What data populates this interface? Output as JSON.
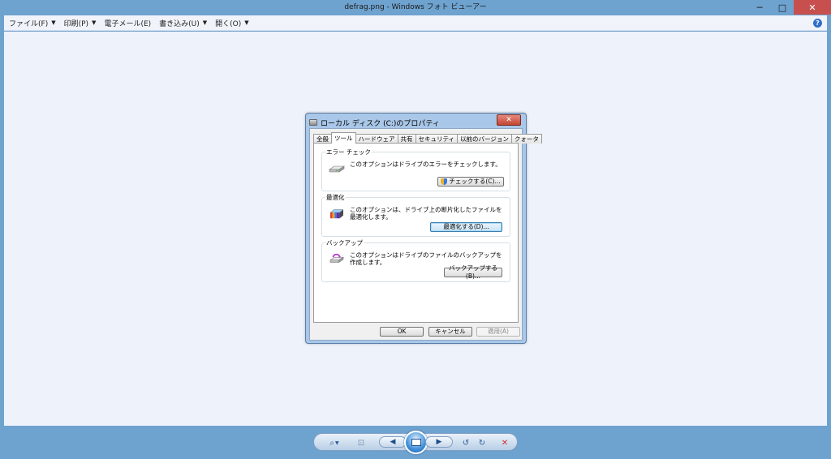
{
  "window": {
    "title": "defrag.png - Windows フォト ビューアー",
    "controls": {
      "minimize": "─",
      "maximize": "□",
      "close": "✕"
    }
  },
  "menubar": {
    "items": [
      {
        "label": "ファイル(F)",
        "icon": "chevron-down-icon"
      },
      {
        "label": "印刷(P)",
        "icon": "chevron-down-icon"
      },
      {
        "label": "電子メール(E)"
      },
      {
        "label": "書き込み(U)",
        "icon": "chevron-down-icon"
      },
      {
        "label": "開く(O)",
        "icon": "chevron-down-icon"
      }
    ],
    "help": "?"
  },
  "dialog": {
    "title": "ローカル ディスク (C:)のプロパティ",
    "close": "✕",
    "tabs": [
      "全般",
      "ツール",
      "ハードウェア",
      "共有",
      "セキュリティ",
      "以前のバージョン",
      "クォータ"
    ],
    "active_tab": "ツール",
    "groups": {
      "error_check": {
        "label": "エラー チェック",
        "description": "このオプションはドライブのエラーをチェックします。",
        "button": "チェックする(C)..."
      },
      "defrag": {
        "label": "最適化",
        "description": "このオプションは、ドライブ上の断片化したファイルを最適化します。",
        "button": "最適化する(D)..."
      },
      "backup": {
        "label": "バックアップ",
        "description": "このオプションはドライブのファイルのバックアップを作成します。",
        "button": "バックアップする(B)..."
      }
    },
    "buttons": {
      "ok": "OK",
      "cancel": "キャンセル",
      "apply": "適用(A)"
    }
  },
  "controlbar": {
    "zoom": "⌕",
    "actual_size": "⊡",
    "previous": "◀",
    "next": "▶",
    "rotate_left": "↺",
    "rotate_right": "↻",
    "delete": "✕"
  }
}
